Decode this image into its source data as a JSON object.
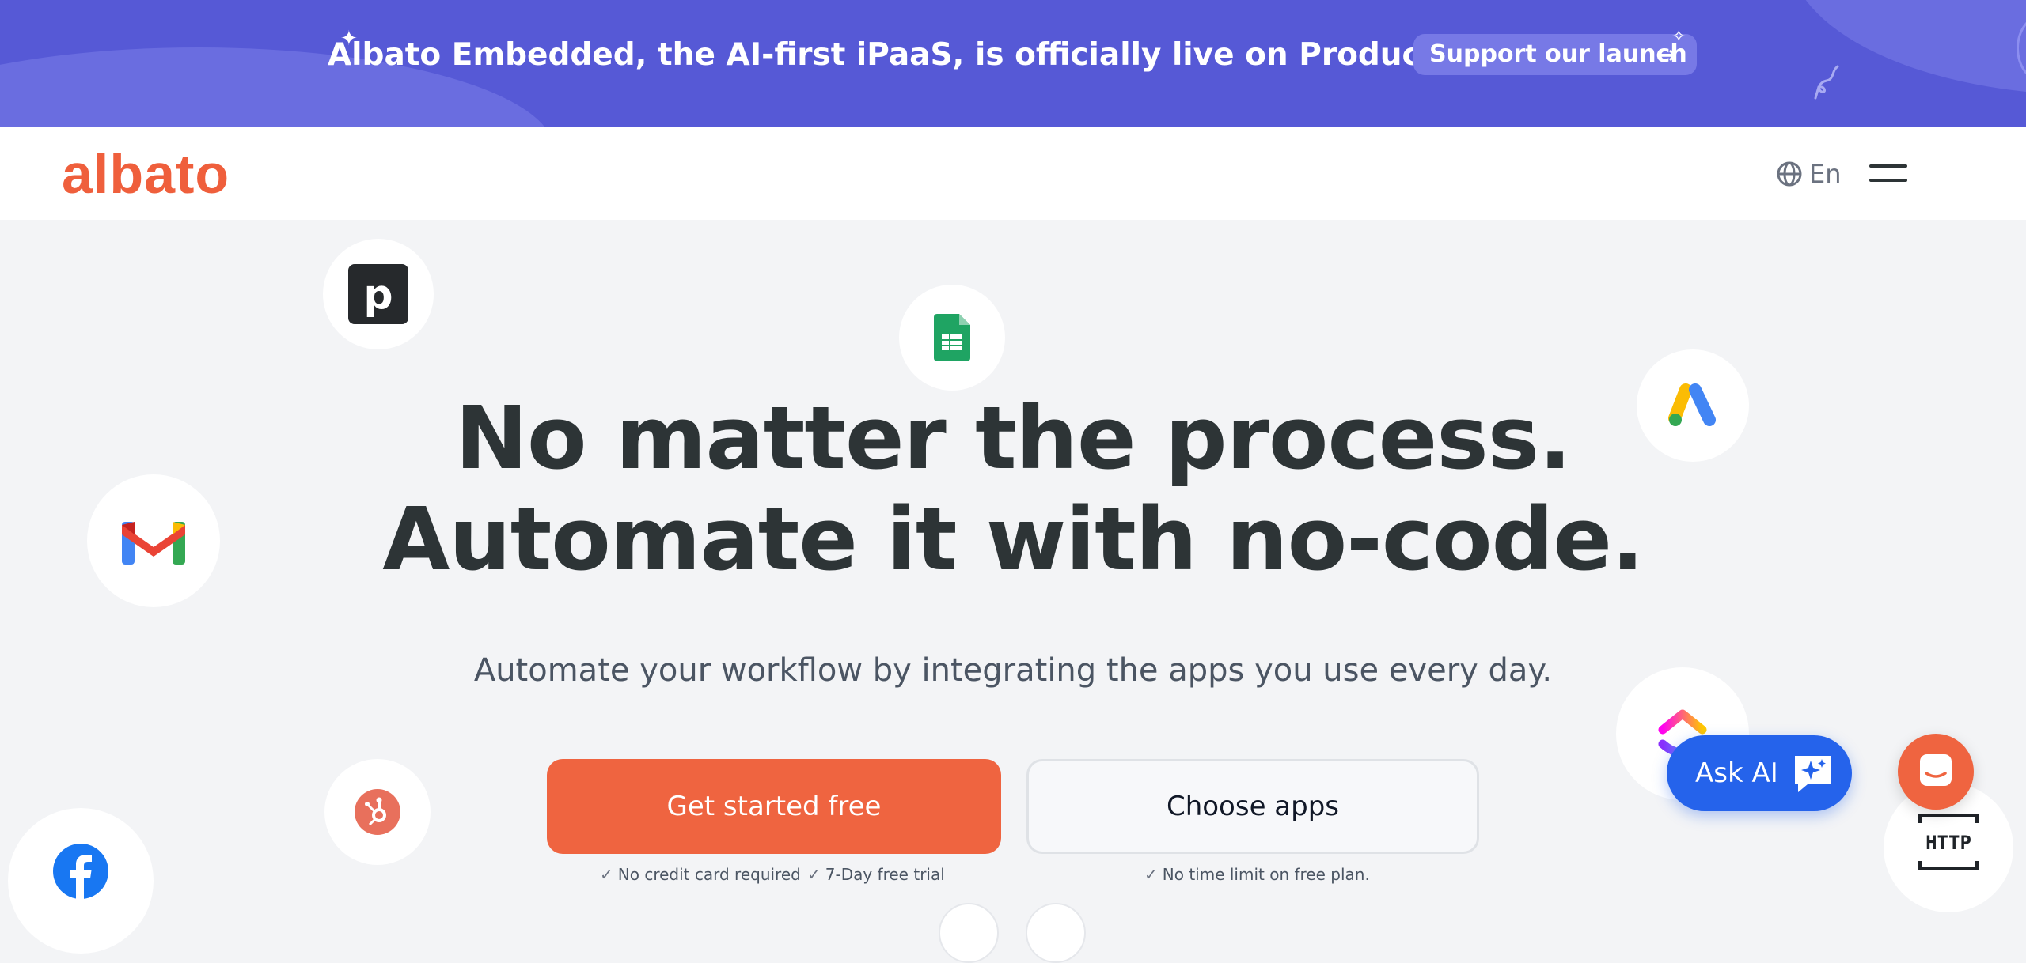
{
  "banner": {
    "text": "Albato Embedded, the AI-first iPaaS, is officially live on Product Hunt!",
    "support_label": "Support our launch",
    "arrow": "→"
  },
  "header": {
    "logo": "albato",
    "language": "En"
  },
  "hero": {
    "title_line1": "No matter the process.",
    "title_line2": "Automate it with no-code.",
    "subtitle": "Automate your workflow by integrating the apps you use every day.",
    "cta_primary": "Get started free",
    "cta_secondary": "Choose apps",
    "notes": {
      "no_credit_card": "No credit card required",
      "trial": "7-Day free trial",
      "no_time_limit": "No time limit on free plan."
    }
  },
  "floating_icons": [
    "pipedrive-icon",
    "google-sheets-icon",
    "google-ads-icon",
    "gmail-icon",
    "clickup-icon",
    "hubspot-icon",
    "facebook-icon",
    "http-icon"
  ],
  "http_label": "HTTP",
  "ask_ai": {
    "label": "Ask AI"
  },
  "colors": {
    "banner": "#5659d6",
    "brand": "#ef5f3c",
    "cta": "#ef6440",
    "ask_ai": "#2563eb",
    "heading": "#2d3436"
  }
}
